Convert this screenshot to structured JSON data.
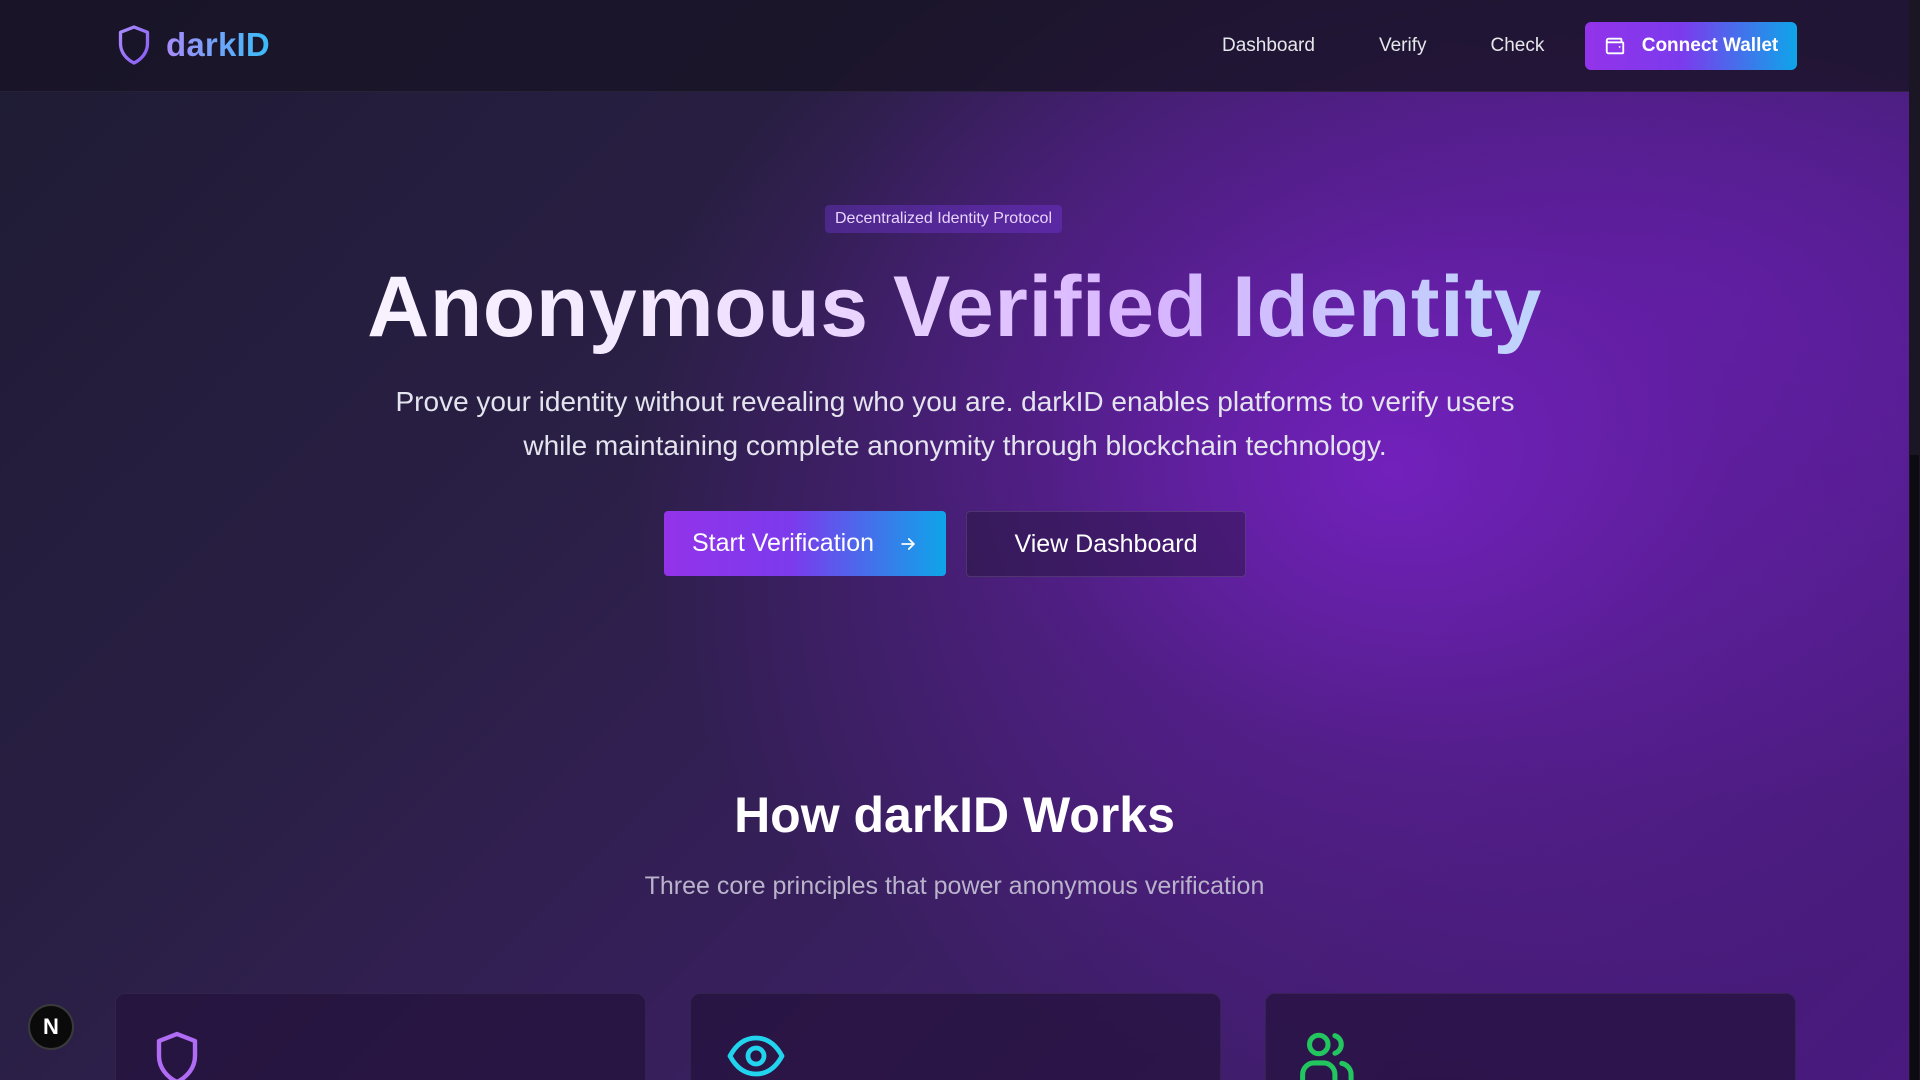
{
  "nav": {
    "brand": "darkID",
    "links": [
      {
        "label": "Dashboard"
      },
      {
        "label": "Verify"
      },
      {
        "label": "Check"
      }
    ],
    "connect_label": "Connect Wallet"
  },
  "hero": {
    "badge": "Decentralized Identity Protocol",
    "title": "Anonymous Verified Identity",
    "subtitle": "Prove your identity without revealing who you are. darkID enables platforms to verify users while maintaining complete anonymity through blockchain technology.",
    "primary_cta": "Start Verification",
    "secondary_cta": "View Dashboard"
  },
  "how": {
    "title": "How darkID Works",
    "subtitle": "Three core principles that power anonymous verification",
    "cards": [
      {
        "icon": "shield-icon",
        "accent": "#a855f7"
      },
      {
        "icon": "eye-icon",
        "accent": "#22d3ee"
      },
      {
        "icon": "users-icon",
        "accent": "#22c55e"
      }
    ]
  },
  "floating_badge": "N",
  "colors": {
    "accent_purple": "#9333ea",
    "accent_cyan": "#0ea5e9",
    "card_green": "#22c55e"
  }
}
